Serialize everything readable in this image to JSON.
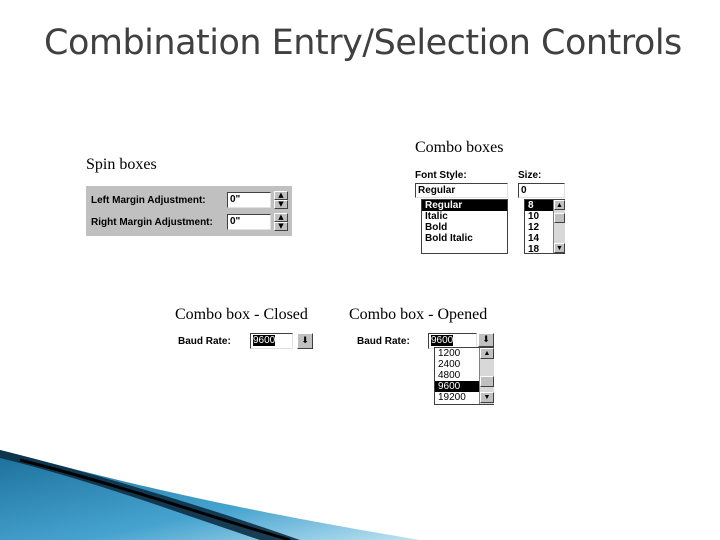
{
  "title": "Combination Entry/Selection Controls",
  "captions": {
    "spin": "Spin boxes",
    "combo": "Combo boxes",
    "closed": "Combo box - Closed",
    "opened": "Combo box - Opened"
  },
  "spin": {
    "left_label": "Left Margin Adjustment:",
    "left_value": "0\"",
    "right_label": "Right Margin Adjustment:",
    "right_value": "0\""
  },
  "combo": {
    "font_style_label": "Font Style:",
    "font_style_value": "Regular",
    "font_styles": [
      "Regular",
      "Italic",
      "Bold",
      "Bold Italic"
    ],
    "font_style_selected": "Regular",
    "size_label": "Size:",
    "size_value": "0",
    "sizes": [
      "8",
      "10",
      "12",
      "14",
      "18"
    ],
    "size_selected": "8"
  },
  "baud_closed": {
    "label": "Baud Rate:",
    "value": "9600"
  },
  "baud_opened": {
    "label": "Baud Rate:",
    "value": "9600",
    "options": [
      "1200",
      "2400",
      "4800",
      "9600",
      "19200"
    ],
    "selected": "9600"
  },
  "icons": {
    "spin_up": "▲",
    "spin_down": "▼",
    "dropdown": "⬇",
    "scroll_up": "▲",
    "scroll_down": "▼"
  }
}
